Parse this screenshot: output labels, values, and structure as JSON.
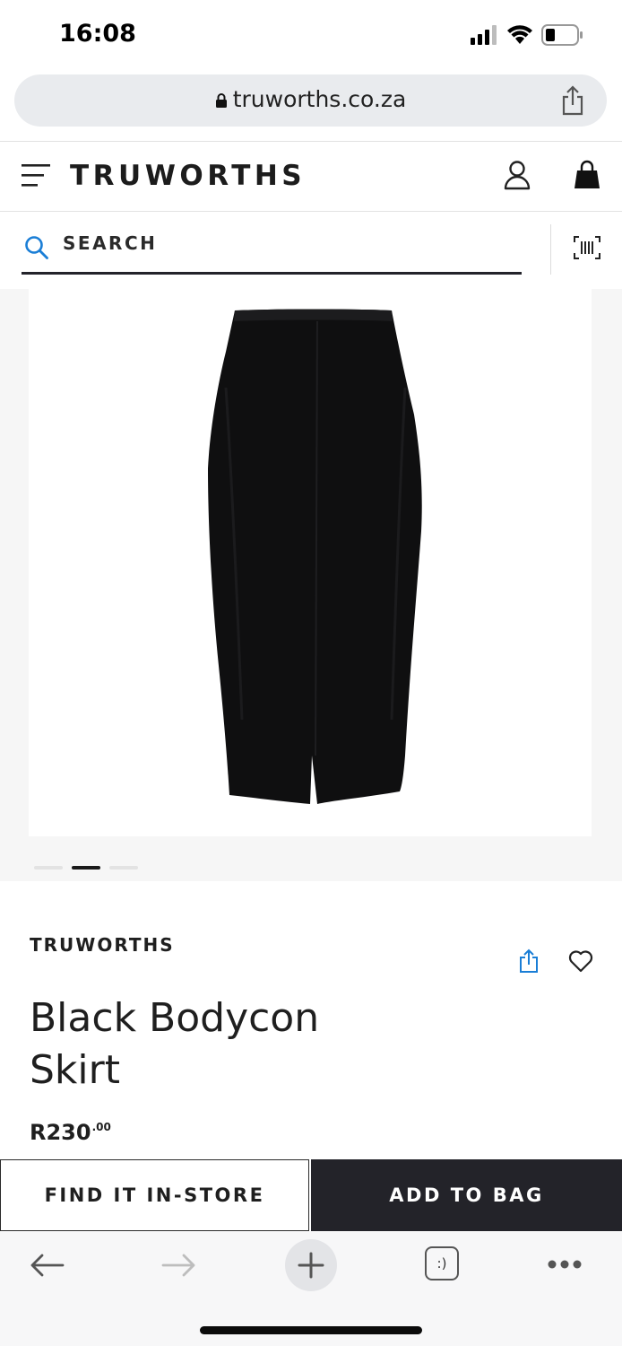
{
  "status_bar": {
    "time": "16:08",
    "battery_level": 0.25
  },
  "browser": {
    "url": "truworths.co.za"
  },
  "header": {
    "logo": "TRUWORTHS"
  },
  "search": {
    "placeholder": "SEARCH"
  },
  "gallery": {
    "image_count": 3,
    "active_index": 1
  },
  "product": {
    "brand": "TRUWORTHS",
    "name_line1": "Black Bodycon",
    "name_line2": "Skirt",
    "price_main": "R230",
    "price_cents": ".00"
  },
  "actions": {
    "find_in_store": "FIND IT IN-STORE",
    "add_to_bag": "ADD TO BAG"
  },
  "toolbar": {
    "tabs_glyph": ":)"
  },
  "colors": {
    "accent_blue": "#1a7ed6",
    "dark": "#232329"
  }
}
